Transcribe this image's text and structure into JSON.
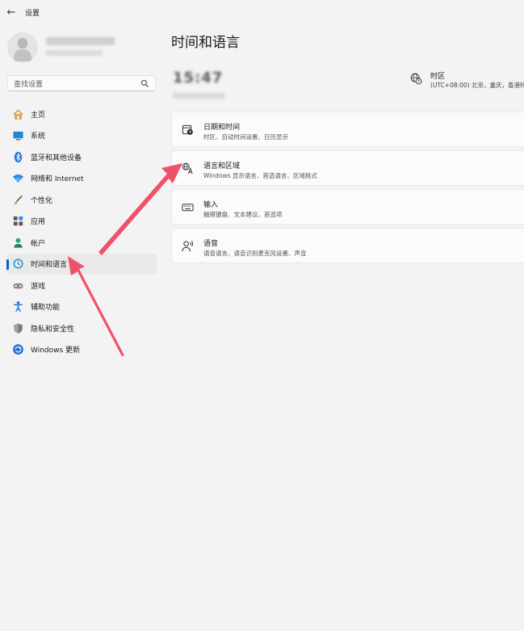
{
  "titlebar": {
    "back_glyph": "←",
    "app_title": "设置"
  },
  "search": {
    "placeholder": "查找设置",
    "icon": "search-icon"
  },
  "nav": {
    "items": [
      {
        "label": "主页",
        "icon": "home-icon"
      },
      {
        "label": "系统",
        "icon": "display-icon"
      },
      {
        "label": "蓝牙和其他设备",
        "icon": "bluetooth-icon"
      },
      {
        "label": "网络和 Internet",
        "icon": "wifi-icon"
      },
      {
        "label": "个性化",
        "icon": "brush-icon"
      },
      {
        "label": "应用",
        "icon": "apps-icon"
      },
      {
        "label": "帐户",
        "icon": "account-icon"
      },
      {
        "label": "时间和语言",
        "icon": "time-language-icon",
        "selected": true
      },
      {
        "label": "游戏",
        "icon": "gamepad-icon"
      },
      {
        "label": "辅助功能",
        "icon": "accessibility-icon"
      },
      {
        "label": "隐私和安全性",
        "icon": "shield-icon"
      },
      {
        "label": "Windows 更新",
        "icon": "update-icon"
      }
    ]
  },
  "page": {
    "title": "时间和语言"
  },
  "clock": {
    "time": "15:47"
  },
  "timezone": {
    "title": "时区",
    "value": "(UTC+08:00) 北京，重庆，香港特"
  },
  "cards": [
    {
      "title": "日期和时间",
      "desc": "时区、自动时间设置、日历显示",
      "icon": "calendar-clock-icon"
    },
    {
      "title": "语言和区域",
      "desc": "Windows 显示语言、首选语言、区域格式",
      "icon": "language-icon"
    },
    {
      "title": "输入",
      "desc": "触摸键盘、文本建议、首选项",
      "icon": "keyboard-icon"
    },
    {
      "title": "语音",
      "desc": "语音语言、语音识别麦克风设置、声音",
      "icon": "speech-icon"
    }
  ],
  "colors": {
    "accent": "#0067c0",
    "arrow": "#f0506a",
    "background": "#f3f3f3"
  }
}
